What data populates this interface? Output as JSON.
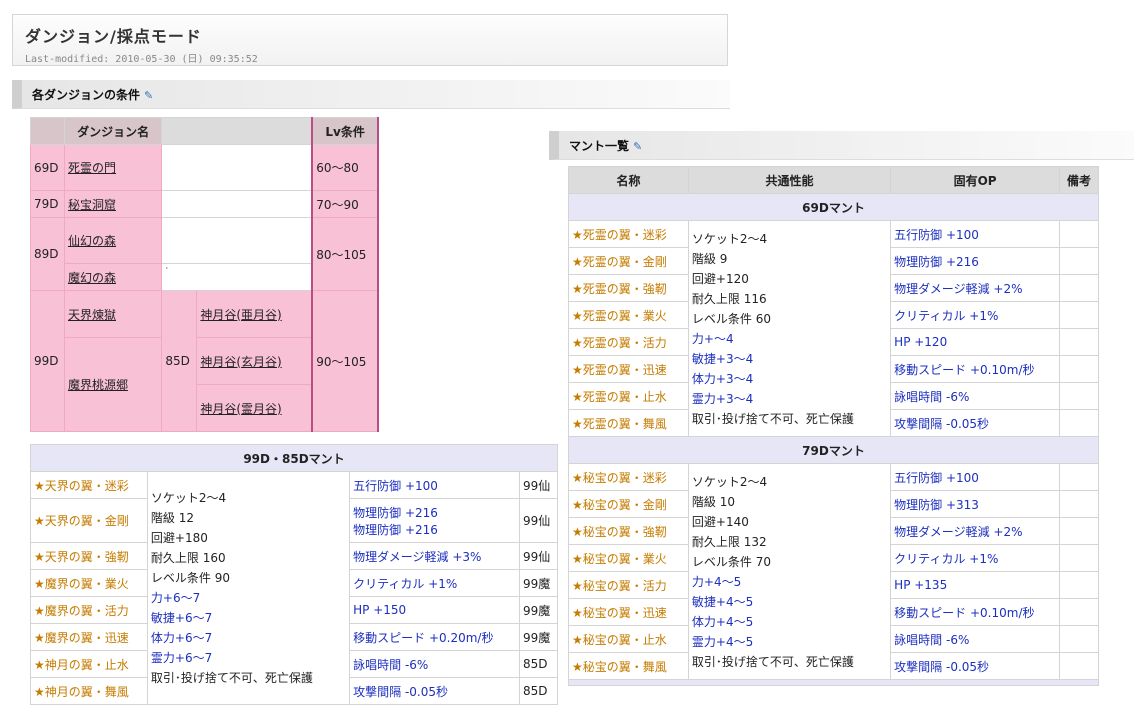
{
  "page": {
    "title": "ダンジョン/採点モード",
    "last_modified": "Last-modified: 2010-05-30 (日) 09:35:52"
  },
  "section_dungeon": {
    "heading": "各ダンジョンの条件",
    "col_name": "ダンジョン名",
    "col_lv": "Lv条件",
    "rows": [
      {
        "code": "69D",
        "name": "死霊の門",
        "lv": "60～80"
      },
      {
        "code": "79D",
        "name": "秘宝洞窟",
        "lv": "70～90"
      },
      {
        "code": "89D",
        "name": "仙幻の森",
        "name2": "魔幻の森",
        "dot": "·",
        "lv": "80～105"
      },
      {
        "code": "99D",
        "name": "天界煉獄",
        "name2": "魔界桃源郷",
        "lv": "90～105",
        "sub_code": "85D",
        "sub": [
          "神月谷(亜月谷)",
          "神月谷(玄月谷)",
          "神月谷(霊月谷)"
        ]
      }
    ]
  },
  "section_mantle": {
    "heading": "マント一覧"
  },
  "table_99": {
    "group": "99D・85Dマント",
    "items": [
      {
        "name": "★天界の翼・迷彩",
        "op": [
          "五行防御 +100"
        ],
        "note": "99仙"
      },
      {
        "name": "★天界の翼・金剛",
        "op": [
          "物理防御 +216",
          "物理防御 +216"
        ],
        "note": "99仙"
      },
      {
        "name": "★天界の翼・強靭",
        "op": [
          "物理ダメージ軽減 +3%"
        ],
        "note": "99仙"
      },
      {
        "name": "★魔界の翼・業火",
        "op": [
          "クリティカル +1%"
        ],
        "note": "99魔"
      },
      {
        "name": "★魔界の翼・活力",
        "op": [
          "HP +150"
        ],
        "note": "99魔"
      },
      {
        "name": "★魔界の翼・迅速",
        "op": [
          "移動スピード +0.20m/秒"
        ],
        "note": "99魔"
      },
      {
        "name": "★神月の翼・止水",
        "op": [
          "詠唱時間 -6%"
        ],
        "note": "85D"
      },
      {
        "name": "★神月の翼・舞風",
        "op": [
          "攻撃間隔 -0.05秒"
        ],
        "note": "85D"
      }
    ],
    "common_black": [
      "ソケット2～4",
      "階級 12",
      "回避+180",
      "耐久上限 160",
      "レベル条件 90"
    ],
    "common_blue": [
      "力+6～7",
      "敏捷+6～7",
      "体力+6～7",
      "霊力+6～7"
    ],
    "common_tail": "取引･投げ捨て不可、死亡保護"
  },
  "table_main": {
    "headers": [
      "名称",
      "共通性能",
      "固有OP",
      "備考"
    ],
    "groups": [
      {
        "label": "69Dマント",
        "items": [
          {
            "name": "★死霊の翼・迷彩",
            "op": "五行防御 +100"
          },
          {
            "name": "★死霊の翼・金剛",
            "op": "物理防御 +216"
          },
          {
            "name": "★死霊の翼・強靭",
            "op": "物理ダメージ軽減 +2%"
          },
          {
            "name": "★死霊の翼・業火",
            "op": "クリティカル +1%"
          },
          {
            "name": "★死霊の翼・活力",
            "op": "HP +120"
          },
          {
            "name": "★死霊の翼・迅速",
            "op": "移動スピード +0.10m/秒"
          },
          {
            "name": "★死霊の翼・止水",
            "op": "詠唱時間 -6%"
          },
          {
            "name": "★死霊の翼・舞風",
            "op": "攻撃間隔 -0.05秒"
          }
        ],
        "common_black": [
          "ソケット2～4",
          "階級 9",
          "回避+120",
          "耐久上限 116",
          "レベル条件 60"
        ],
        "common_blue": [
          "力+～4",
          "敏捷+3～4",
          "体力+3～4",
          "霊力+3～4"
        ],
        "common_tail": "取引･投げ捨て不可、死亡保護"
      },
      {
        "label": "79Dマント",
        "items": [
          {
            "name": "★秘宝の翼・迷彩",
            "op": "五行防御 +100"
          },
          {
            "name": "★秘宝の翼・金剛",
            "op": "物理防御 +313"
          },
          {
            "name": "★秘宝の翼・強靭",
            "op": "物理ダメージ軽減 +2%"
          },
          {
            "name": "★秘宝の翼・業火",
            "op": "クリティカル +1%"
          },
          {
            "name": "★秘宝の翼・活力",
            "op": "HP +135"
          },
          {
            "name": "★秘宝の翼・迅速",
            "op": "移動スピード +0.10m/秒"
          },
          {
            "name": "★秘宝の翼・止水",
            "op": "詠唱時間 -6%"
          },
          {
            "name": "★秘宝の翼・舞風",
            "op": "攻撃間隔 -0.05秒"
          }
        ],
        "common_black": [
          "ソケット2～4",
          "階級 10",
          "回避+140",
          "耐久上限 132",
          "レベル条件 70"
        ],
        "common_blue": [
          "力+4～5",
          "敏捷+4～5",
          "体力+4～5",
          "霊力+4～5"
        ],
        "common_tail": "取引･投げ捨て不可、死亡保護"
      }
    ]
  }
}
